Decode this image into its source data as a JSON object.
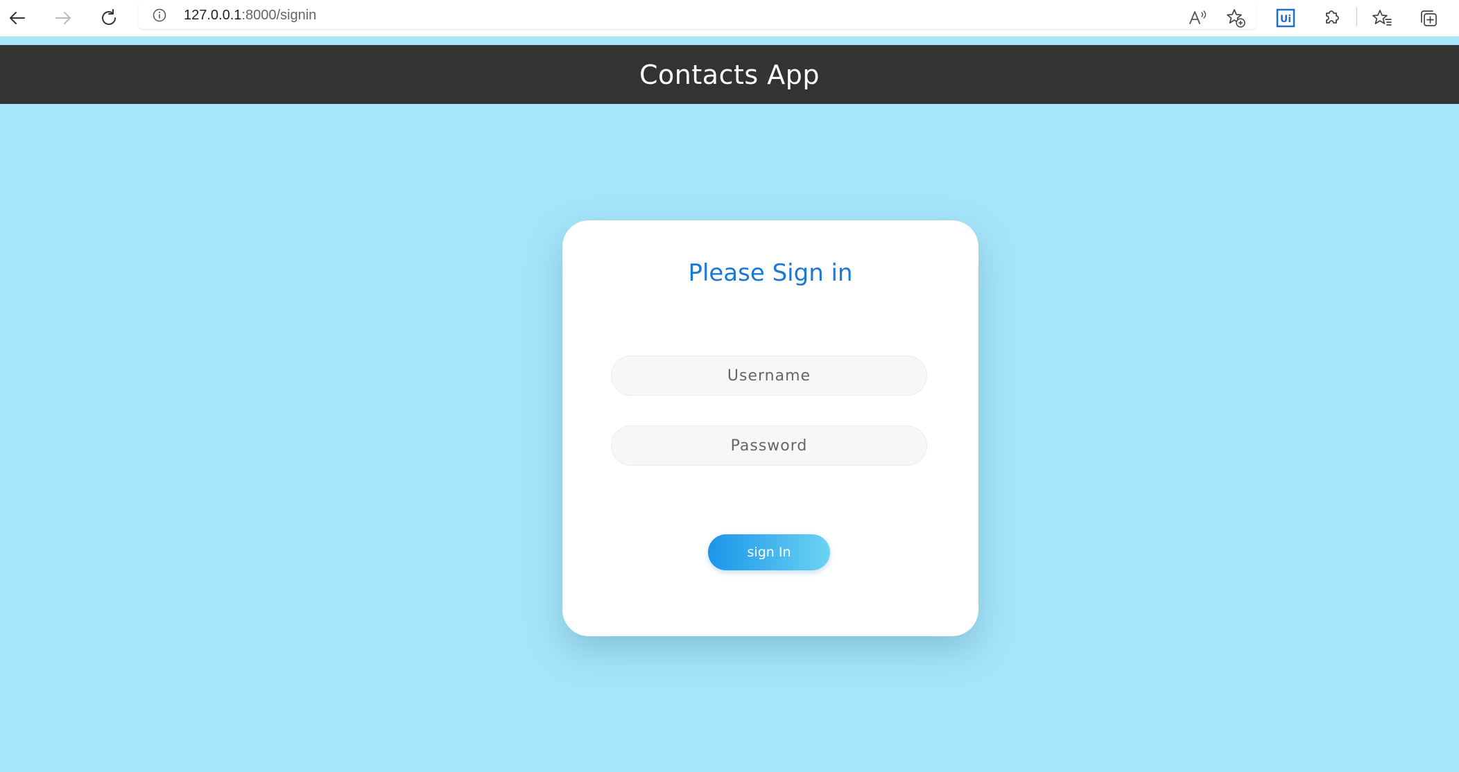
{
  "browser": {
    "url_host": "127.0.0.1",
    "url_rest": ":8000/signin",
    "icons": [
      "back-arrow-icon",
      "forward-arrow-icon",
      "reload-icon",
      "info-icon",
      "read-aloud-icon",
      "add-favorite-icon",
      "uipath-extension-icon",
      "extensions-icon",
      "favorites-icon",
      "collections-icon"
    ]
  },
  "header": {
    "title": "Contacts App",
    "background": "#333333"
  },
  "signin": {
    "title": "Please Sign in",
    "username_placeholder": "Username",
    "password_placeholder": "Password",
    "button_label": "sign In",
    "accent_color": "#1a78d8"
  },
  "page": {
    "background": "#a6e5fa"
  }
}
